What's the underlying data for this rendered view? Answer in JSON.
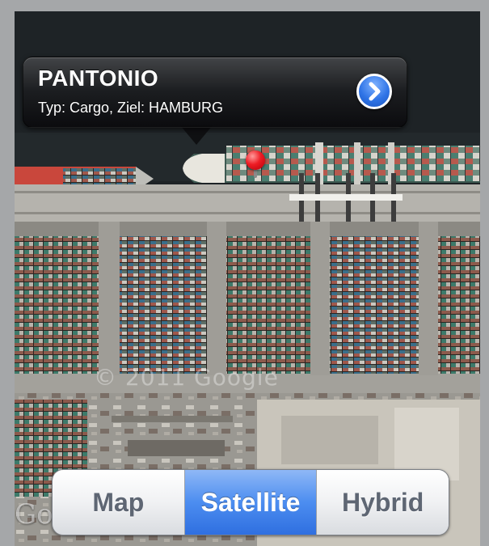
{
  "callout": {
    "title": "PANTONIO",
    "subtitle": "Typ: Cargo, Ziel: HAMBURG",
    "disclosure_icon": "chevron-right-icon"
  },
  "map": {
    "watermark": "© 2011 Google",
    "logo": "Go",
    "pin_color": "#ee1c24"
  },
  "segmented_control": {
    "options": [
      "Map",
      "Satellite",
      "Hybrid"
    ],
    "selected": "Satellite",
    "accent": "#3b7ff0"
  }
}
